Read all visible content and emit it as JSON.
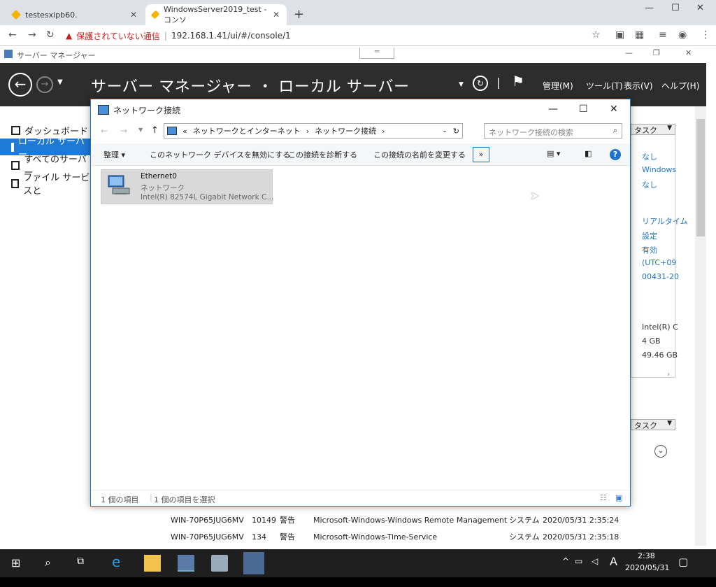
{
  "browser": {
    "tab1_title": "testesxipb60.",
    "tab2_title": "WindowsServer2019_test - コンソ",
    "security": "保護されていない通信",
    "url": "192.168.1.41/ui/#/console/1"
  },
  "server_manager": {
    "window_title": "サーバー マネージャー",
    "breadcrumb": "サーバー マネージャー ・ ローカル サーバー",
    "menus": [
      "管理(M)",
      "ツール(T)",
      "表示(V)",
      "ヘルプ(H)"
    ],
    "nav": [
      "ダッシュボード",
      "ローカル サーバー",
      "すべてのサーバー",
      "ファイル サービスと"
    ],
    "task_label": "タスク",
    "right_values": [
      "なし",
      "Windows",
      "なし",
      "リアルタイム",
      "設定",
      "有効",
      "(UTC+09",
      "00431-20",
      "Intel(R) C",
      "4 GB",
      "49.46 GB"
    ],
    "events": [
      {
        "server": "WIN-70P65JUG6MV",
        "id": "10149",
        "level": "警告",
        "source": "Microsoft-Windows-Windows Remote Management",
        "log": "システム",
        "date": "2020/05/31 2:35:24"
      },
      {
        "server": "WIN-70P65JUG6MV",
        "id": "134",
        "level": "警告",
        "source": "Microsoft-Windows-Time-Service",
        "log": "システム",
        "date": "2020/05/31 2:35:18"
      }
    ]
  },
  "dialog": {
    "title": "ネットワーク接続",
    "path_prefix": "«",
    "path1": "ネットワークとインターネット",
    "path2": "ネットワーク接続",
    "search_placeholder": "ネットワーク接続の検索",
    "commands": [
      "整理 ▾",
      "このネットワーク デバイスを無効にする",
      "この接続を診断する",
      "この接続の名前を変更する"
    ],
    "more": "»",
    "help": "?",
    "item": {
      "name": "Ethernet0",
      "type": "ネットワーク",
      "adapter": "Intel(R) 82574L Gigabit Network C..."
    },
    "status_count": "1 個の項目",
    "status_selected": "1 個の項目を選択"
  },
  "taskbar": {
    "time": "2:38",
    "date": "2020/05/31",
    "ime": "A"
  }
}
